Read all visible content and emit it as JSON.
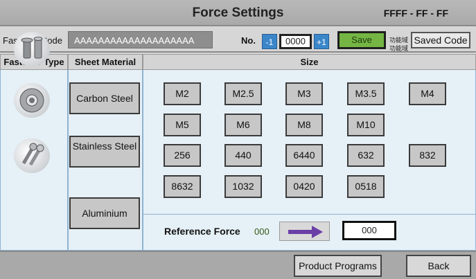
{
  "header": {
    "title": "Force Settings",
    "status_code": "FFFF - FF - FF"
  },
  "code_row": {
    "fastener_code_label": "Fastener Code",
    "fastener_code_value": "AAAAAAAAAAAAAAAAAAAA",
    "no_label": "No.",
    "minus_label": "-1",
    "plus_label": "+1",
    "no_value": "0000",
    "save_label": "Save",
    "function_label_1": "功能域",
    "function_label_2": "功能域",
    "saved_code_label": "Saved Code"
  },
  "table": {
    "headers": {
      "fastener_type": "Fastener Type",
      "sheet_material": "Sheet Material",
      "size": "Size"
    },
    "fastener_types": [
      {
        "icon": "rivet-nut-icon"
      },
      {
        "icon": "washer-nut-icon"
      },
      {
        "icon": "bolts-icon"
      }
    ],
    "materials": [
      "Carbon Steel",
      "Stainless Steel",
      "Aluminium"
    ],
    "sizes": [
      "M2",
      "M2.5",
      "M3",
      "M3.5",
      "M4",
      "M5",
      "M6",
      "M8",
      "M10",
      "256",
      "440",
      "6440",
      "632",
      "832",
      "8632",
      "1032",
      "0420",
      "0518"
    ]
  },
  "reference": {
    "label": "Reference Force",
    "value": "000",
    "field_value": "000",
    "arrow_icon": "arrow-right-icon",
    "arrow_color": "#6a3fa6"
  },
  "footer": {
    "product_programs_label": "Product Programs",
    "back_label": "Back"
  },
  "colors": {
    "save_green": "#74b544",
    "step_blue": "#3b86c9",
    "panel_blue": "#e6f0f7"
  }
}
